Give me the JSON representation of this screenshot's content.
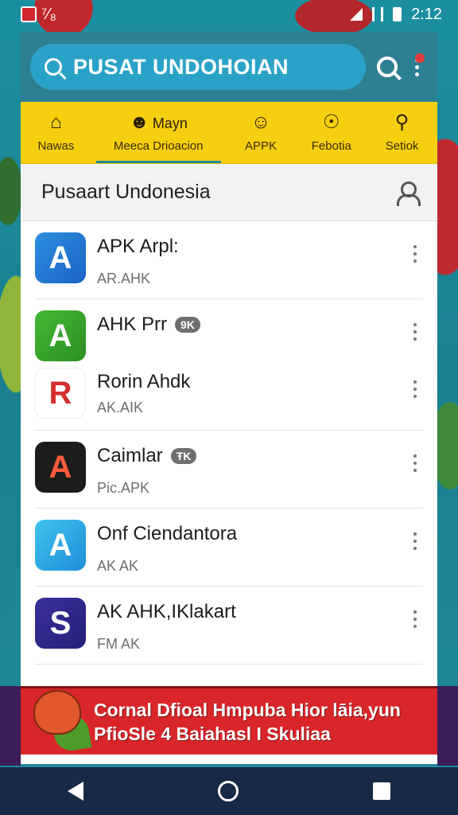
{
  "status_bar": {
    "left_text": "⁷⁄₈",
    "time": "2:12"
  },
  "search": {
    "text": "PUSAT UNDOHOIAN"
  },
  "tabs": [
    {
      "label": "Nawas",
      "icon": "home-icon"
    },
    {
      "label": "Meeca Drioacion",
      "sub": "Mayn",
      "icon": "face-icon"
    },
    {
      "label": "APPK",
      "icon": "smile-icon"
    },
    {
      "label": "Febotia",
      "icon": "compass-icon"
    },
    {
      "label": "Setiok",
      "icon": "chat-icon"
    }
  ],
  "section": {
    "title": "Pusaart Undonesia"
  },
  "apps": [
    {
      "name": "APK Arpl:",
      "sub": "AR.AHK",
      "badge": "",
      "icon_letter": "A"
    },
    {
      "name": "AHK Prr",
      "sub": "",
      "badge": "9K",
      "icon_letter": "A"
    },
    {
      "name": "Rorin Ahdk",
      "sub": "AK.AIK",
      "badge": "",
      "icon_letter": "R"
    },
    {
      "name": "Caimlar",
      "sub": "Pic.APK",
      "badge": "ŦK",
      "icon_letter": "A"
    },
    {
      "name": "Onf Ciendantora",
      "sub": "AK AK",
      "badge": "",
      "icon_letter": "A"
    },
    {
      "name": "AK AHK,IKlakart",
      "sub": "FM AK",
      "badge": "",
      "icon_letter": "S"
    }
  ],
  "banner": {
    "line1": "Cornal Dfioal Hmpuba Hior lāia,yun",
    "line2": "PfioSle 4 Baiahasl I Skuliaa"
  }
}
